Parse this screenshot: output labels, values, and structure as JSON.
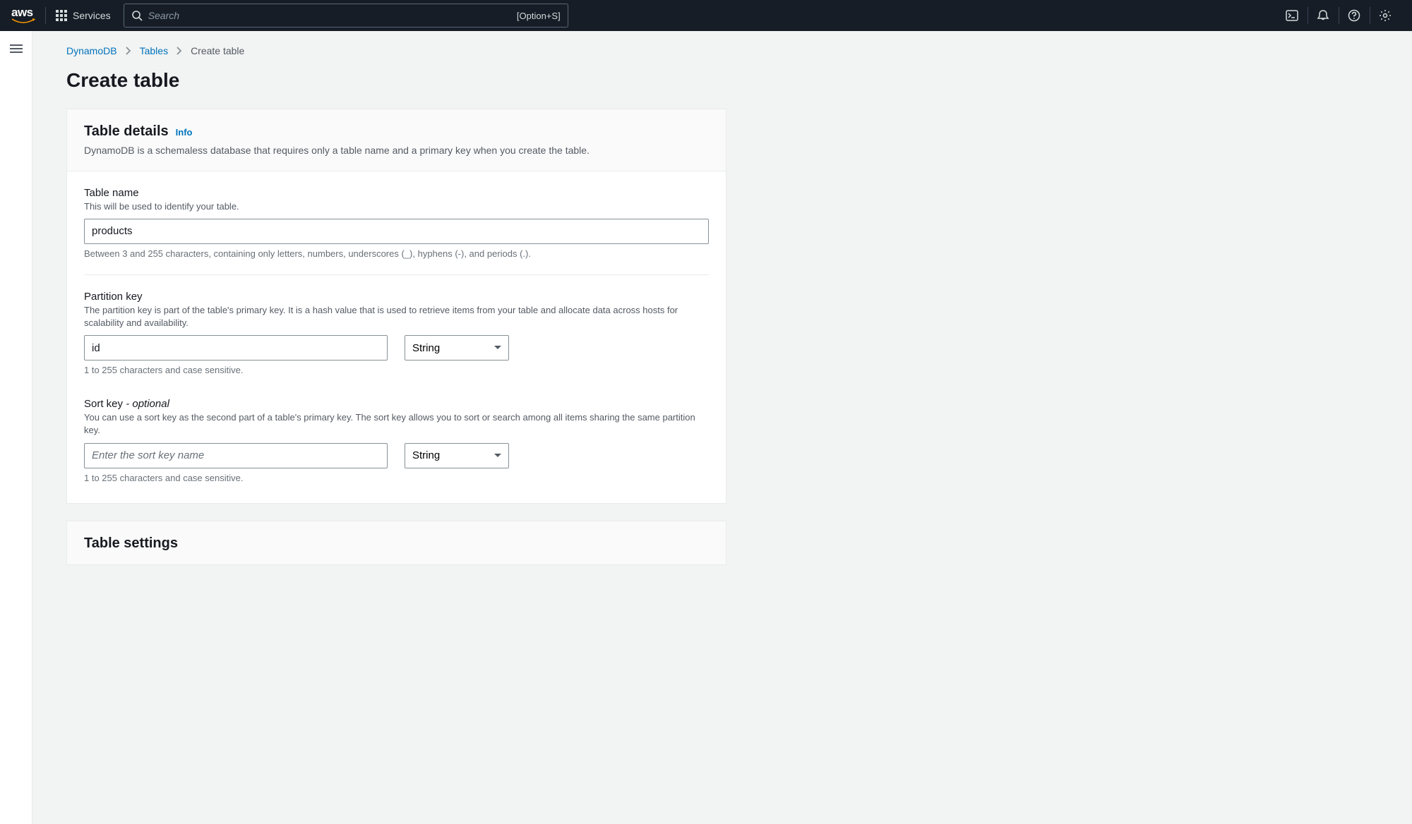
{
  "nav": {
    "services_label": "Services",
    "search_placeholder": "Search",
    "search_shortcut": "[Option+S]"
  },
  "breadcrumbs": {
    "items": [
      {
        "label": "DynamoDB",
        "link": true
      },
      {
        "label": "Tables",
        "link": true
      },
      {
        "label": "Create table",
        "link": false
      }
    ]
  },
  "page": {
    "title": "Create table"
  },
  "table_details": {
    "title": "Table details",
    "info_label": "Info",
    "description": "DynamoDB is a schemaless database that requires only a table name and a primary key when you create the table.",
    "table_name": {
      "label": "Table name",
      "sub": "This will be used to identify your table.",
      "value": "products",
      "hint": "Between 3 and 255 characters, containing only letters, numbers, underscores (_), hyphens (-), and periods (.)."
    },
    "partition_key": {
      "label": "Partition key",
      "sub": "The partition key is part of the table's primary key. It is a hash value that is used to retrieve items from your table and allocate data across hosts for scalability and availability.",
      "value": "id",
      "type": "String",
      "hint": "1 to 255 characters and case sensitive."
    },
    "sort_key": {
      "label": "Sort key",
      "optional": "- optional",
      "sub": "You can use a sort key as the second part of a table's primary key. The sort key allows you to sort or search among all items sharing the same partition key.",
      "placeholder": "Enter the sort key name",
      "value": "",
      "type": "String",
      "hint": "1 to 255 characters and case sensitive."
    }
  },
  "table_settings": {
    "title": "Table settings"
  }
}
